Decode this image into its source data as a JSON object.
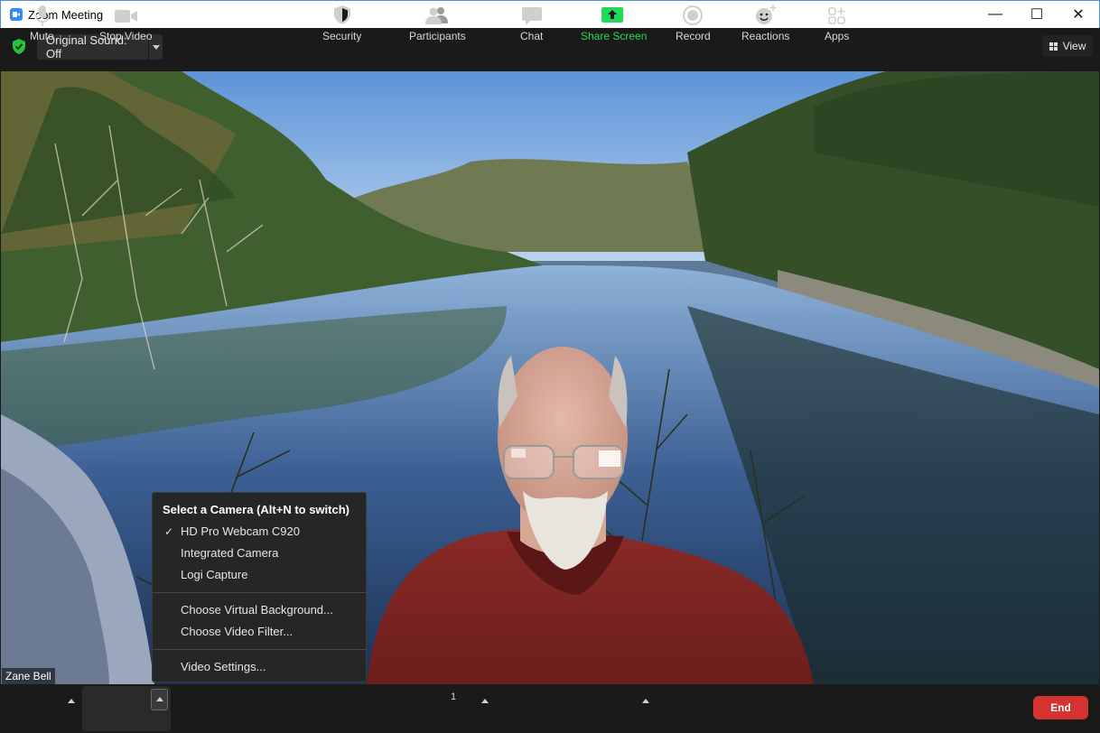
{
  "window": {
    "title": "Zoom Meeting",
    "minimize_glyph": "—",
    "maximize_glyph": "☐",
    "close_glyph": "✕"
  },
  "topbar": {
    "security_status_icon": "shield-check-icon",
    "original_sound_label": "Original Sound: Off",
    "view_label": "View"
  },
  "video": {
    "participant_name": "Zane Bell"
  },
  "camera_menu": {
    "header": "Select a Camera (Alt+N to switch)",
    "cameras": [
      {
        "label": "HD Pro Webcam C920",
        "selected": true
      },
      {
        "label": "Integrated Camera",
        "selected": false
      },
      {
        "label": "Logi Capture",
        "selected": false
      }
    ],
    "check_glyph": "✓",
    "options": [
      "Choose Virtual Background...",
      "Choose Video Filter..."
    ],
    "settings": "Video Settings..."
  },
  "toolbar": {
    "mute": "Mute",
    "stop_video": "Stop Video",
    "security": "Security",
    "participants": "Participants",
    "participants_count": "1",
    "chat": "Chat",
    "share_screen": "Share Screen",
    "record": "Record",
    "reactions": "Reactions",
    "apps": "Apps",
    "end": "End"
  },
  "colors": {
    "accent_share": "#23d959",
    "end_button": "#d63232",
    "zoom_blue": "#2d8cff",
    "shield_green": "#23c43b"
  }
}
